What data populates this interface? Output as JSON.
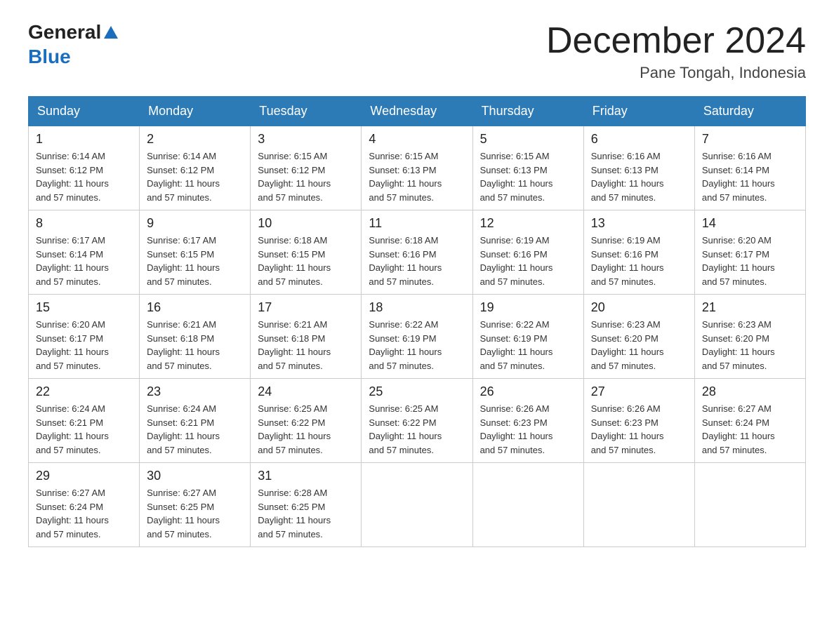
{
  "header": {
    "logo": {
      "text_general": "General",
      "text_blue": "Blue"
    },
    "month_title": "December 2024",
    "location": "Pane Tongah, Indonesia"
  },
  "weekdays": [
    "Sunday",
    "Monday",
    "Tuesday",
    "Wednesday",
    "Thursday",
    "Friday",
    "Saturday"
  ],
  "weeks": [
    [
      {
        "day": "1",
        "sunrise": "6:14 AM",
        "sunset": "6:12 PM",
        "daylight": "11 hours and 57 minutes."
      },
      {
        "day": "2",
        "sunrise": "6:14 AM",
        "sunset": "6:12 PM",
        "daylight": "11 hours and 57 minutes."
      },
      {
        "day": "3",
        "sunrise": "6:15 AM",
        "sunset": "6:12 PM",
        "daylight": "11 hours and 57 minutes."
      },
      {
        "day": "4",
        "sunrise": "6:15 AM",
        "sunset": "6:13 PM",
        "daylight": "11 hours and 57 minutes."
      },
      {
        "day": "5",
        "sunrise": "6:15 AM",
        "sunset": "6:13 PM",
        "daylight": "11 hours and 57 minutes."
      },
      {
        "day": "6",
        "sunrise": "6:16 AM",
        "sunset": "6:13 PM",
        "daylight": "11 hours and 57 minutes."
      },
      {
        "day": "7",
        "sunrise": "6:16 AM",
        "sunset": "6:14 PM",
        "daylight": "11 hours and 57 minutes."
      }
    ],
    [
      {
        "day": "8",
        "sunrise": "6:17 AM",
        "sunset": "6:14 PM",
        "daylight": "11 hours and 57 minutes."
      },
      {
        "day": "9",
        "sunrise": "6:17 AM",
        "sunset": "6:15 PM",
        "daylight": "11 hours and 57 minutes."
      },
      {
        "day": "10",
        "sunrise": "6:18 AM",
        "sunset": "6:15 PM",
        "daylight": "11 hours and 57 minutes."
      },
      {
        "day": "11",
        "sunrise": "6:18 AM",
        "sunset": "6:16 PM",
        "daylight": "11 hours and 57 minutes."
      },
      {
        "day": "12",
        "sunrise": "6:19 AM",
        "sunset": "6:16 PM",
        "daylight": "11 hours and 57 minutes."
      },
      {
        "day": "13",
        "sunrise": "6:19 AM",
        "sunset": "6:16 PM",
        "daylight": "11 hours and 57 minutes."
      },
      {
        "day": "14",
        "sunrise": "6:20 AM",
        "sunset": "6:17 PM",
        "daylight": "11 hours and 57 minutes."
      }
    ],
    [
      {
        "day": "15",
        "sunrise": "6:20 AM",
        "sunset": "6:17 PM",
        "daylight": "11 hours and 57 minutes."
      },
      {
        "day": "16",
        "sunrise": "6:21 AM",
        "sunset": "6:18 PM",
        "daylight": "11 hours and 57 minutes."
      },
      {
        "day": "17",
        "sunrise": "6:21 AM",
        "sunset": "6:18 PM",
        "daylight": "11 hours and 57 minutes."
      },
      {
        "day": "18",
        "sunrise": "6:22 AM",
        "sunset": "6:19 PM",
        "daylight": "11 hours and 57 minutes."
      },
      {
        "day": "19",
        "sunrise": "6:22 AM",
        "sunset": "6:19 PM",
        "daylight": "11 hours and 57 minutes."
      },
      {
        "day": "20",
        "sunrise": "6:23 AM",
        "sunset": "6:20 PM",
        "daylight": "11 hours and 57 minutes."
      },
      {
        "day": "21",
        "sunrise": "6:23 AM",
        "sunset": "6:20 PM",
        "daylight": "11 hours and 57 minutes."
      }
    ],
    [
      {
        "day": "22",
        "sunrise": "6:24 AM",
        "sunset": "6:21 PM",
        "daylight": "11 hours and 57 minutes."
      },
      {
        "day": "23",
        "sunrise": "6:24 AM",
        "sunset": "6:21 PM",
        "daylight": "11 hours and 57 minutes."
      },
      {
        "day": "24",
        "sunrise": "6:25 AM",
        "sunset": "6:22 PM",
        "daylight": "11 hours and 57 minutes."
      },
      {
        "day": "25",
        "sunrise": "6:25 AM",
        "sunset": "6:22 PM",
        "daylight": "11 hours and 57 minutes."
      },
      {
        "day": "26",
        "sunrise": "6:26 AM",
        "sunset": "6:23 PM",
        "daylight": "11 hours and 57 minutes."
      },
      {
        "day": "27",
        "sunrise": "6:26 AM",
        "sunset": "6:23 PM",
        "daylight": "11 hours and 57 minutes."
      },
      {
        "day": "28",
        "sunrise": "6:27 AM",
        "sunset": "6:24 PM",
        "daylight": "11 hours and 57 minutes."
      }
    ],
    [
      {
        "day": "29",
        "sunrise": "6:27 AM",
        "sunset": "6:24 PM",
        "daylight": "11 hours and 57 minutes."
      },
      {
        "day": "30",
        "sunrise": "6:27 AM",
        "sunset": "6:25 PM",
        "daylight": "11 hours and 57 minutes."
      },
      {
        "day": "31",
        "sunrise": "6:28 AM",
        "sunset": "6:25 PM",
        "daylight": "11 hours and 57 minutes."
      },
      null,
      null,
      null,
      null
    ]
  ],
  "labels": {
    "sunrise": "Sunrise:",
    "sunset": "Sunset:",
    "daylight": "Daylight:"
  }
}
